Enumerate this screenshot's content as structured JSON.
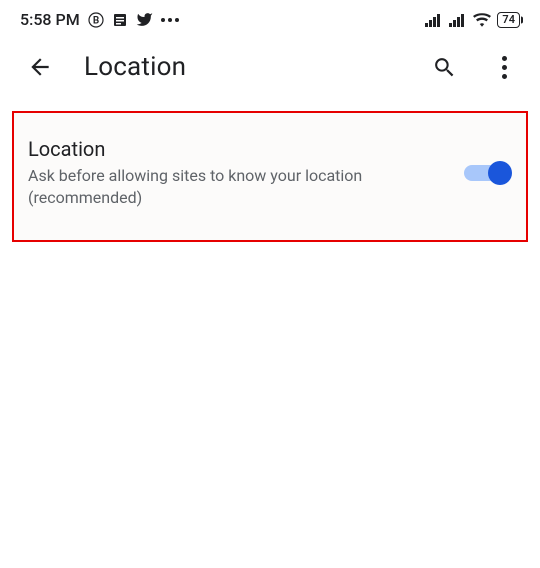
{
  "statusbar": {
    "time": "5:58 PM",
    "battery": "74"
  },
  "appbar": {
    "title": "Location"
  },
  "setting": {
    "title": "Location",
    "description": "Ask before allowing sites to know your location (recommended)",
    "enabled": true
  }
}
